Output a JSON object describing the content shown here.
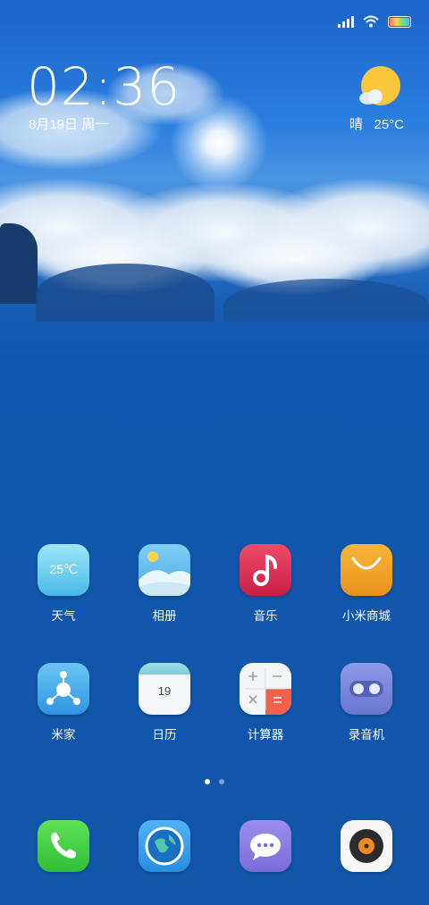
{
  "status_bar": {
    "signal": "signal-icon",
    "wifi": "wifi-icon",
    "battery": "battery-icon"
  },
  "clock": {
    "time": "02:36",
    "date": "8月19日 周一"
  },
  "weather": {
    "condition": "晴",
    "temperature": "25°C"
  },
  "apps_row1": [
    {
      "label": "天气",
      "icon": "weather-app-icon",
      "icon_text": "25℃"
    },
    {
      "label": "相册",
      "icon": "gallery-app-icon"
    },
    {
      "label": "音乐",
      "icon": "music-app-icon"
    },
    {
      "label": "小米商城",
      "icon": "mi-store-app-icon"
    }
  ],
  "apps_row2": [
    {
      "label": "米家",
      "icon": "mi-home-app-icon"
    },
    {
      "label": "日历",
      "icon": "calendar-app-icon",
      "icon_text": "19"
    },
    {
      "label": "计算器",
      "icon": "calculator-app-icon"
    },
    {
      "label": "录音机",
      "icon": "recorder-app-icon"
    }
  ],
  "pager": {
    "pages": 2,
    "current": 1
  },
  "dock": [
    {
      "icon": "phone-app-icon"
    },
    {
      "icon": "browser-app-icon"
    },
    {
      "icon": "messages-app-icon"
    },
    {
      "icon": "music-player-app-icon"
    }
  ],
  "colors": {
    "background": "#1256aa",
    "sky": "#2a7fe0"
  }
}
